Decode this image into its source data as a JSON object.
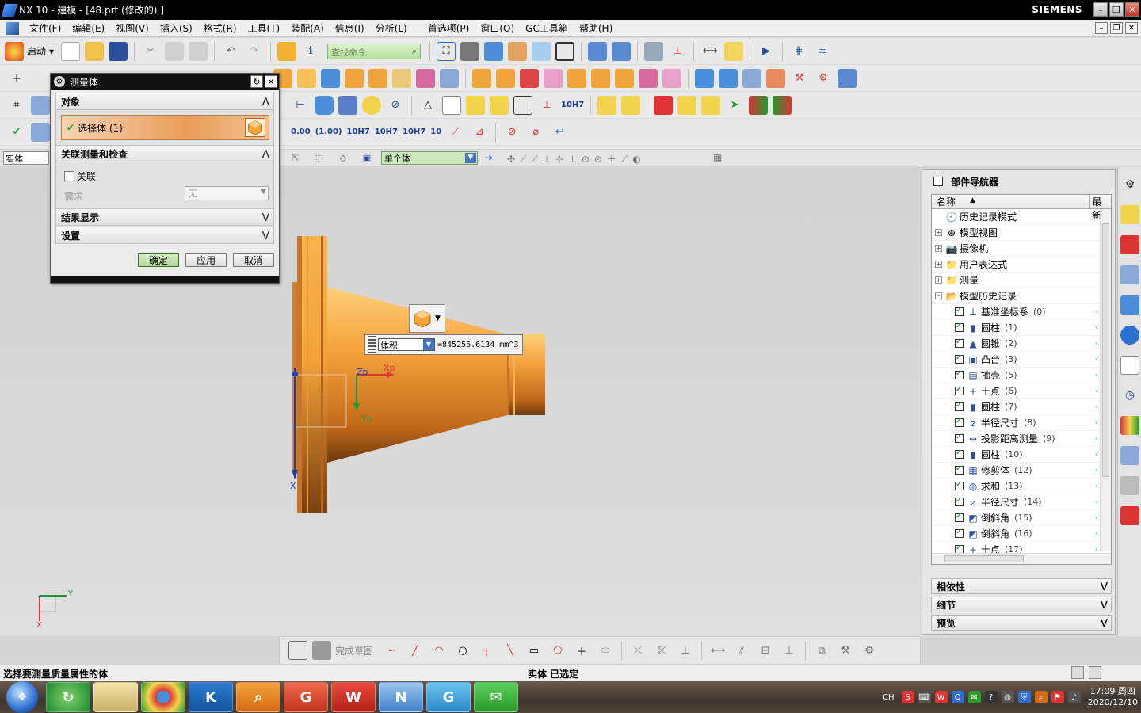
{
  "window": {
    "title": "NX 10 - 建模 - [48.prt (修改的) ]",
    "brand": "SIEMENS",
    "min": "–",
    "restore": "❐",
    "close": "✕"
  },
  "menu": {
    "items": [
      "文件(F)",
      "编辑(E)",
      "视图(V)",
      "插入(S)",
      "格式(R)",
      "工具(T)",
      "装配(A)",
      "信息(I)",
      "分析(L)",
      "首选项(P)",
      "窗口(O)",
      "GC工具箱",
      "帮助(H)"
    ],
    "mdi": [
      "–",
      "❐",
      "✕"
    ]
  },
  "toolbar": {
    "start_label": "启动",
    "search_placeholder": "查找命令",
    "tol_labels": [
      "0.00",
      "(1.00)",
      "10H7",
      "10H7",
      "10H7",
      "10"
    ]
  },
  "selection_bar": {
    "filter_value": "实体",
    "scope_value": "单个体"
  },
  "dialog": {
    "title": "测量体",
    "groups": {
      "object": "对象",
      "assoc": "关联测量和检查",
      "result": "结果显示",
      "settings": "设置"
    },
    "select_body_label": "选择体 (1)",
    "assoc_checkbox": "关联",
    "requirement_label": "需求",
    "requirement_value": "无",
    "buttons": {
      "ok": "确定",
      "apply": "应用",
      "cancel": "取消"
    }
  },
  "measure": {
    "type": "体积",
    "value": "=845256.6134 mm^3"
  },
  "axes": {
    "zp": "Zp",
    "xp": "Xp",
    "yp": "Yp",
    "x": "X",
    "y": "Y"
  },
  "navigator": {
    "title": "部件导航器",
    "col_name": "名称",
    "col_last": "最新",
    "top_items": [
      {
        "label": "历史记录模式",
        "expand": "",
        "icon": "🕘"
      },
      {
        "label": "模型视图",
        "expand": "+",
        "icon": "⊕"
      },
      {
        "label": "摄像机",
        "expand": "+",
        "icon": "📷"
      },
      {
        "label": "用户表达式",
        "expand": "+",
        "icon": "📁"
      },
      {
        "label": "测量",
        "expand": "+",
        "icon": "📁"
      },
      {
        "label": "模型历史记录",
        "expand": "-",
        "icon": "📂"
      }
    ],
    "features": [
      {
        "label": "基准坐标系",
        "num": "(0)",
        "icon": "⟂"
      },
      {
        "label": "圆柱",
        "num": "(1)",
        "icon": "▮"
      },
      {
        "label": "圆锥",
        "num": "(2)",
        "icon": "▲"
      },
      {
        "label": "凸台",
        "num": "(3)",
        "icon": "▣"
      },
      {
        "label": "抽壳",
        "num": "(5)",
        "icon": "▤"
      },
      {
        "label": "十点",
        "num": "(6)",
        "icon": "+"
      },
      {
        "label": "圆柱",
        "num": "(7)",
        "icon": "▮"
      },
      {
        "label": "半径尺寸",
        "num": "(8)",
        "icon": "⌀"
      },
      {
        "label": "投影距离测量",
        "num": "(9)",
        "icon": "↔"
      },
      {
        "label": "圆柱",
        "num": "(10)",
        "icon": "▮"
      },
      {
        "label": "修剪体",
        "num": "(12)",
        "icon": "▦"
      },
      {
        "label": "求和",
        "num": "(13)",
        "icon": "◍"
      },
      {
        "label": "半径尺寸",
        "num": "(14)",
        "icon": "⌀"
      },
      {
        "label": "倒斜角",
        "num": "(15)",
        "icon": "◩"
      },
      {
        "label": "倒斜角",
        "num": "(16)",
        "icon": "◩"
      },
      {
        "label": "十点",
        "num": "(17)",
        "icon": "+"
      }
    ],
    "sections": [
      "相依性",
      "细节",
      "预览"
    ]
  },
  "sketch_toolbar": {
    "done_label": "完成草图"
  },
  "status": {
    "prompt": "选择要测量质量属性的体",
    "state": "实体 已选定"
  },
  "taskbar": {
    "apps": [
      "chrome",
      "KS",
      "search",
      "pdf",
      "WPS",
      "NX",
      "G",
      "wechat"
    ],
    "tray_lang": "CH",
    "clock_time": "17:09 周四",
    "clock_date": "2020/12/10"
  }
}
